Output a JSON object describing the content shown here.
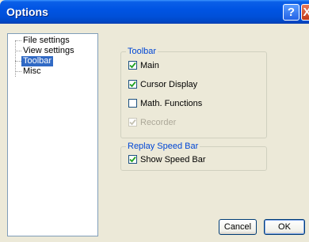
{
  "window": {
    "title": "Options",
    "help_glyph": "?",
    "close_glyph": "X"
  },
  "tree": {
    "items": [
      {
        "label": "File settings",
        "selected": false
      },
      {
        "label": "View settings",
        "selected": false
      },
      {
        "label": "Toolbar",
        "selected": true
      },
      {
        "label": "Misc",
        "selected": false
      }
    ]
  },
  "toolbar_group": {
    "title": "Toolbar",
    "options": [
      {
        "label": "Main",
        "checked": true,
        "enabled": true
      },
      {
        "label": "Cursor Display",
        "checked": true,
        "enabled": true
      },
      {
        "label": "Math. Functions",
        "checked": false,
        "enabled": true
      },
      {
        "label": "Recorder",
        "checked": true,
        "enabled": false
      }
    ]
  },
  "replay_group": {
    "title": "Replay Speed Bar",
    "options": [
      {
        "label": "Show Speed Bar",
        "checked": true,
        "enabled": true
      }
    ]
  },
  "buttons": {
    "cancel": "Cancel",
    "ok": "OK"
  },
  "colors": {
    "titlebar": "#0054e3",
    "selection": "#316ac5",
    "group_title": "#0046d5"
  }
}
